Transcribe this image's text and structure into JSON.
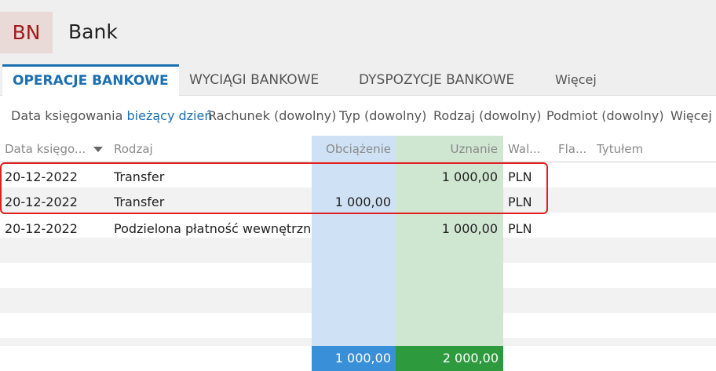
{
  "app": {
    "badge": "BN",
    "title": "Bank"
  },
  "tabs": [
    {
      "label": "OPERACJE BANKOWE"
    },
    {
      "label": "WYCIĄGI BANKOWE"
    },
    {
      "label": "DYSPOZYCJE BANKOWE"
    },
    {
      "label": "Więcej"
    }
  ],
  "filters": {
    "date_label": "Data księgowania",
    "date_value": "bieżący dzień",
    "account": "Rachunek (dowolny)",
    "type": "Typ (dowolny)",
    "kind": "Rodzaj (dowolny)",
    "subject": "Podmiot (dowolny)",
    "more": "Więcej"
  },
  "columns": {
    "date": "Data księgo...",
    "kind": "Rodzaj",
    "debit": "Obciążenie",
    "credit": "Uznanie",
    "currency": "Wal...",
    "flag": "Fla...",
    "title": "Tytułem"
  },
  "rows": [
    {
      "date": "20-12-2022",
      "kind": "Transfer",
      "debit": "",
      "credit": "1 000,00",
      "currency": "PLN"
    },
    {
      "date": "20-12-2022",
      "kind": "Transfer",
      "debit": "1 000,00",
      "credit": "",
      "currency": "PLN"
    },
    {
      "date": "20-12-2022",
      "kind": "Podzielona płatność wewnętrzna",
      "debit": "",
      "credit": "1 000,00",
      "currency": "PLN"
    }
  ],
  "totals": {
    "debit": "1 000,00",
    "credit": "2 000,00"
  },
  "colors": {
    "accent": "#1c6fb0",
    "debit_col": "#cfe2f5",
    "credit_col": "#cfe6d1",
    "debit_total": "#3a8fd9",
    "credit_total": "#2e9a3e",
    "highlight": "#e02020"
  }
}
